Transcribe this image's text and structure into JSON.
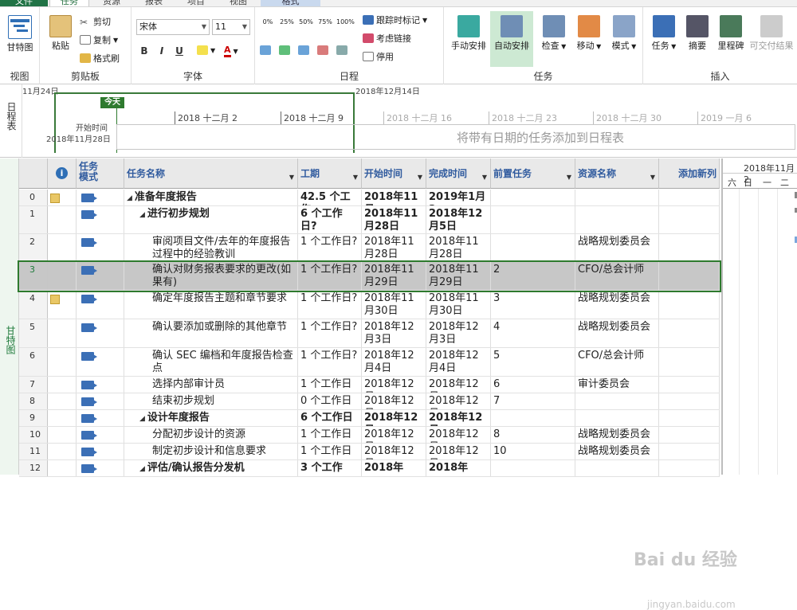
{
  "tabs": [
    "文件",
    "任务",
    "资源",
    "报表",
    "项目",
    "视图",
    "格式"
  ],
  "ribbon": {
    "view": {
      "btn": "甘特图",
      "label": "视图"
    },
    "clipboard": {
      "paste": "粘贴",
      "cut": "剪切",
      "copy": "复制",
      "painter": "格式刷",
      "label": "剪贴板"
    },
    "font": {
      "name": "宋体",
      "size": "11",
      "bold": "B",
      "italic": "I",
      "underline": "U",
      "label": "字体"
    },
    "schedule": {
      "pcts": [
        "0%",
        "25%",
        "50%",
        "75%",
        "100%"
      ],
      "track": "跟踪时标记",
      "respect": "考虑链接",
      "inactivate": "停用",
      "label": "日程"
    },
    "tasks": {
      "manual": "手动安排",
      "auto": "自动安排",
      "inspect": "检查",
      "move": "移动",
      "mode": "模式",
      "label": "任务"
    },
    "insert": {
      "task": "任务",
      "summary": "摘要",
      "milestone": "里程碑",
      "deliverable": "可交付结果",
      "label": "插入"
    }
  },
  "timeline": {
    "side": "日程表",
    "date_left": "11月24日",
    "date_top": "2018年12月14日",
    "today": "今天",
    "start_label": "开始时间",
    "start_date": "2018年11月28日",
    "ticks": [
      "2018 十二月 2",
      "2018 十二月 9",
      "2018 十二月 16",
      "2018 十二月 23",
      "2018 十二月 30",
      "2019 一月 6"
    ],
    "placeholder": "将带有日期的任务添加到日程表"
  },
  "grid": {
    "side": "甘特图",
    "headers": {
      "info": "i",
      "mode": "任务\n模式",
      "name": "任务名称",
      "duration": "工期",
      "start": "开始时间",
      "finish": "完成时间",
      "pred": "前置任务",
      "resource": "资源名称",
      "add": "添加新列"
    },
    "rows": [
      {
        "id": "0",
        "note": true,
        "level": 0,
        "summary": true,
        "name": "准备年度报告",
        "duration": "42.5 个工作",
        "start": "2018年11月",
        "finish": "2019年1月2",
        "pred": "",
        "res": ""
      },
      {
        "id": "1",
        "note": false,
        "level": 1,
        "summary": true,
        "name": "进行初步规划",
        "duration": "6 个工作日?",
        "start": "2018年11月28日",
        "finish": "2018年12月5日",
        "pred": "",
        "res": ""
      },
      {
        "id": "2",
        "note": false,
        "level": 2,
        "summary": false,
        "name": "审阅项目文件/去年的年度报告过程中的经验教训",
        "duration": "1 个工作日?",
        "start": "2018年11月28日",
        "finish": "2018年11月28日",
        "pred": "",
        "res": "战略规划委员会"
      },
      {
        "id": "3",
        "note": false,
        "level": 2,
        "summary": false,
        "name": "确认对财务报表要求的更改(如果有)",
        "duration": "1 个工作日?",
        "start": "2018年11月29日",
        "finish": "2018年11月29日",
        "pred": "2",
        "res": "CFO/总会计师"
      },
      {
        "id": "4",
        "note": true,
        "level": 2,
        "summary": false,
        "name": "确定年度报告主题和章节要求",
        "duration": "1 个工作日?",
        "start": "2018年11月30日",
        "finish": "2018年11月30日",
        "pred": "3",
        "res": "战略规划委员会"
      },
      {
        "id": "5",
        "note": false,
        "level": 2,
        "summary": false,
        "name": "确认要添加或删除的其他章节",
        "duration": "1 个工作日?",
        "start": "2018年12月3日",
        "finish": "2018年12月3日",
        "pred": "4",
        "res": "战略规划委员会"
      },
      {
        "id": "6",
        "note": false,
        "level": 2,
        "summary": false,
        "name": "确认 SEC 编档和年度报告检查点",
        "duration": "1 个工作日?",
        "start": "2018年12月4日",
        "finish": "2018年12月4日",
        "pred": "5",
        "res": "CFO/总会计师"
      },
      {
        "id": "7",
        "note": false,
        "level": 2,
        "summary": false,
        "name": "选择内部审计员",
        "duration": "1 个工作日",
        "start": "2018年12月",
        "finish": "2018年12月",
        "pred": "6",
        "res": "审计委员会"
      },
      {
        "id": "8",
        "note": false,
        "level": 2,
        "summary": false,
        "name": "结束初步规划",
        "duration": "0 个工作日",
        "start": "2018年12月",
        "finish": "2018年12月",
        "pred": "7",
        "res": ""
      },
      {
        "id": "9",
        "note": false,
        "level": 1,
        "summary": true,
        "name": "设计年度报告",
        "duration": "6 个工作日",
        "start": "2018年12月",
        "finish": "2018年12月",
        "pred": "",
        "res": ""
      },
      {
        "id": "10",
        "note": false,
        "level": 2,
        "summary": false,
        "name": "分配初步设计的资源",
        "duration": "1 个工作日",
        "start": "2018年12月",
        "finish": "2018年12月",
        "pred": "8",
        "res": "战略规划委员会"
      },
      {
        "id": "11",
        "note": false,
        "level": 2,
        "summary": false,
        "name": "制定初步设计和信息要求",
        "duration": "1 个工作日",
        "start": "2018年12月",
        "finish": "2018年12月",
        "pred": "10",
        "res": "战略规划委员会"
      },
      {
        "id": "12",
        "note": false,
        "level": 1,
        "summary": true,
        "name": "评估/确认报告分发机",
        "duration": "3 个工作",
        "start": "2018年",
        "finish": "2018年",
        "pred": "",
        "res": ""
      }
    ]
  },
  "gantt": {
    "date": "2018年11月2",
    "days": [
      "六",
      "日",
      "一",
      "二"
    ]
  },
  "watermark": {
    "main": "Bai du 经验",
    "sub": "jingyan.baidu.com"
  }
}
